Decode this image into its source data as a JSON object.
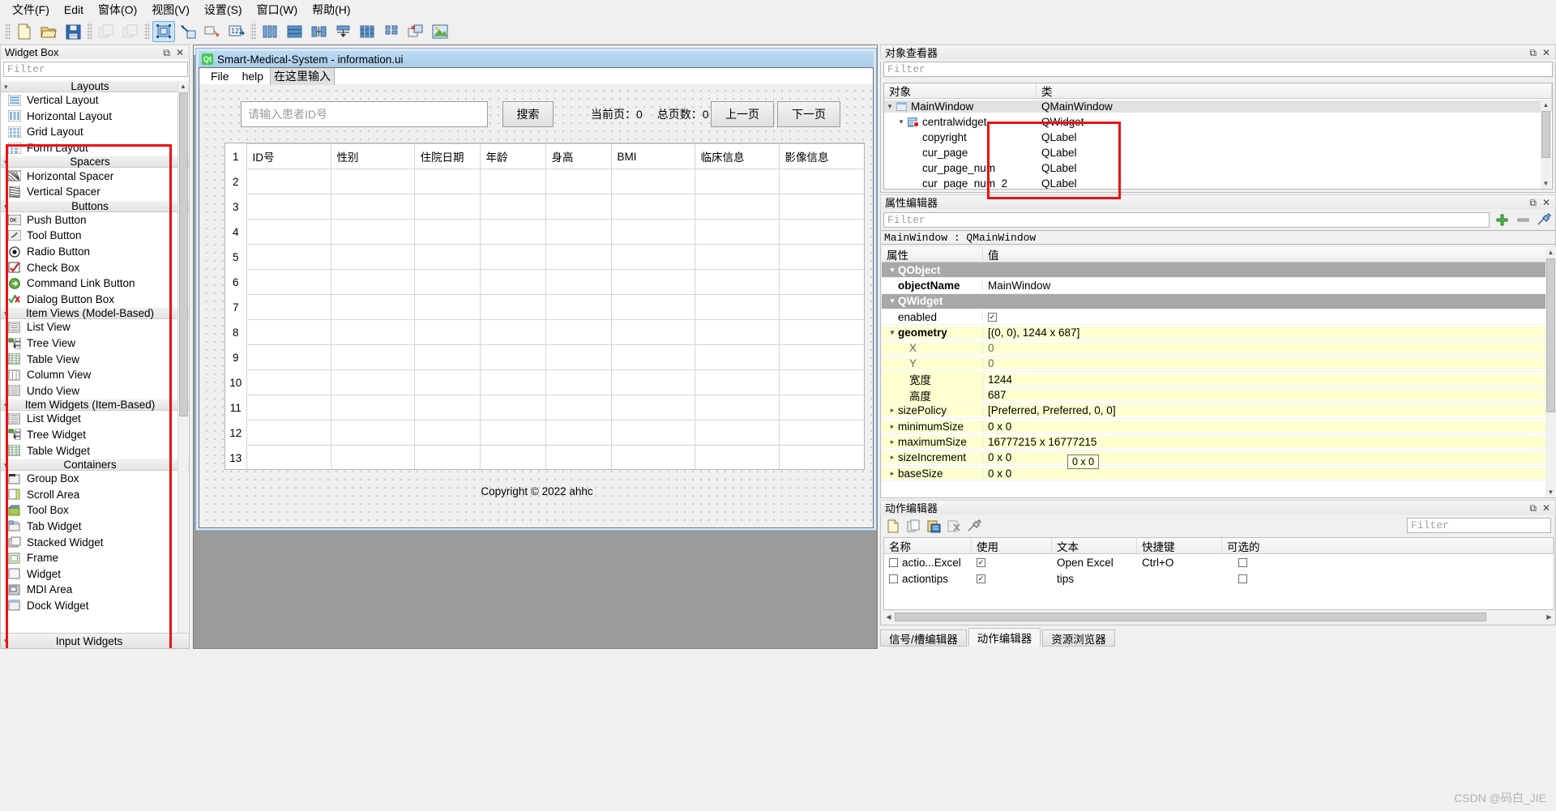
{
  "app": {
    "menu": [
      {
        "label": "文件(F)"
      },
      {
        "label": "Edit"
      },
      {
        "label": "窗体(O)"
      },
      {
        "label": "视图(V)"
      },
      {
        "label": "设置(S)"
      },
      {
        "label": "窗口(W)"
      },
      {
        "label": "帮助(H)"
      }
    ],
    "toolbar_groups": [
      {
        "buttons": [
          {
            "name": "new-form-icon",
            "enabled": true,
            "selected": false
          },
          {
            "name": "open-form-icon",
            "enabled": true,
            "selected": false
          },
          {
            "name": "save-form-icon",
            "enabled": true,
            "selected": false
          }
        ]
      },
      {
        "buttons": [
          {
            "name": "undo-icon",
            "enabled": false,
            "selected": false
          },
          {
            "name": "redo-icon",
            "enabled": false,
            "selected": false
          }
        ]
      },
      {
        "buttons": [
          {
            "name": "edit-widgets-icon",
            "enabled": true,
            "selected": true
          },
          {
            "name": "edit-signals-slots-icon",
            "enabled": true,
            "selected": false
          },
          {
            "name": "edit-buddies-icon",
            "enabled": true,
            "selected": false
          },
          {
            "name": "edit-tab-order-icon",
            "enabled": true,
            "selected": false
          }
        ]
      },
      {
        "buttons": [
          {
            "name": "layout-horizontally-icon",
            "enabled": true,
            "selected": false
          },
          {
            "name": "layout-vertically-icon",
            "enabled": true,
            "selected": false
          },
          {
            "name": "layout-splitter-horizontal-icon",
            "enabled": true,
            "selected": false
          },
          {
            "name": "layout-splitter-vertical-icon",
            "enabled": true,
            "selected": false
          },
          {
            "name": "layout-in-grid-icon",
            "enabled": true,
            "selected": false
          },
          {
            "name": "layout-in-form-icon",
            "enabled": true,
            "selected": false
          },
          {
            "name": "break-layout-icon",
            "enabled": true,
            "selected": false
          },
          {
            "name": "adjust-size-icon",
            "enabled": true,
            "selected": false
          }
        ]
      }
    ]
  },
  "widget_box": {
    "title": "Widget Box",
    "filter_placeholder": "Filter",
    "categories": [
      {
        "label": "Layouts",
        "expanded": true,
        "items": [
          {
            "label": "Vertical Layout",
            "icon": "vertical-layout-icon"
          },
          {
            "label": "Horizontal Layout",
            "icon": "horizontal-layout-icon"
          },
          {
            "label": "Grid Layout",
            "icon": "grid-layout-icon"
          },
          {
            "label": "Form Layout",
            "icon": "form-layout-icon"
          }
        ]
      },
      {
        "label": "Spacers",
        "expanded": true,
        "items": [
          {
            "label": "Horizontal Spacer",
            "icon": "horizontal-spacer-icon"
          },
          {
            "label": "Vertical Spacer",
            "icon": "vertical-spacer-icon"
          }
        ]
      },
      {
        "label": "Buttons",
        "expanded": true,
        "items": [
          {
            "label": "Push Button",
            "icon": "push-button-icon"
          },
          {
            "label": "Tool Button",
            "icon": "tool-button-icon"
          },
          {
            "label": "Radio Button",
            "icon": "radio-button-icon"
          },
          {
            "label": "Check Box",
            "icon": "check-box-icon"
          },
          {
            "label": "Command Link Button",
            "icon": "command-link-button-icon"
          },
          {
            "label": "Dialog Button Box",
            "icon": "dialog-button-box-icon"
          }
        ]
      },
      {
        "label": "Item Views (Model-Based)",
        "expanded": true,
        "items": [
          {
            "label": "List View",
            "icon": "list-view-icon"
          },
          {
            "label": "Tree View",
            "icon": "tree-view-icon"
          },
          {
            "label": "Table View",
            "icon": "table-view-icon"
          },
          {
            "label": "Column View",
            "icon": "column-view-icon"
          },
          {
            "label": "Undo View",
            "icon": "undo-view-icon"
          }
        ]
      },
      {
        "label": "Item Widgets (Item-Based)",
        "expanded": true,
        "items": [
          {
            "label": "List Widget",
            "icon": "list-widget-icon"
          },
          {
            "label": "Tree Widget",
            "icon": "tree-widget-icon"
          },
          {
            "label": "Table Widget",
            "icon": "table-widget-icon"
          }
        ]
      },
      {
        "label": "Containers",
        "expanded": true,
        "items": [
          {
            "label": "Group Box",
            "icon": "group-box-icon"
          },
          {
            "label": "Scroll Area",
            "icon": "scroll-area-icon"
          },
          {
            "label": "Tool Box",
            "icon": "tool-box-icon"
          },
          {
            "label": "Tab Widget",
            "icon": "tab-widget-icon"
          },
          {
            "label": "Stacked Widget",
            "icon": "stacked-widget-icon"
          },
          {
            "label": "Frame",
            "icon": "frame-icon"
          },
          {
            "label": "Widget",
            "icon": "widget-icon"
          },
          {
            "label": "MDI Area",
            "icon": "mdi-area-icon"
          },
          {
            "label": "Dock Widget",
            "icon": "dock-widget-icon"
          }
        ]
      }
    ],
    "bottom_category": {
      "label": "Input Widgets",
      "expanded": false
    }
  },
  "form_window": {
    "title": "Smart-Medical-System - information.ui",
    "qt_badge": "Qt",
    "menu": [
      {
        "label": "File"
      },
      {
        "label": "help"
      },
      {
        "label": "在这里输入",
        "is_hint": true
      }
    ],
    "search_input_placeholder": "请输入患者ID号",
    "search_button": "搜索",
    "page_labels": [
      {
        "label": "当前页：0"
      },
      {
        "label": "总页数：0"
      }
    ],
    "prev_button": "上一页",
    "next_button": "下一页",
    "table": {
      "columns": [
        "ID号",
        "性别",
        "住院日期",
        "年龄",
        "身高",
        "BMI",
        "临床信息",
        "影像信息"
      ],
      "row_numbers": [
        "1",
        "2",
        "3",
        "4",
        "5",
        "6",
        "7",
        "8",
        "9",
        "10",
        "11",
        "12",
        "13"
      ]
    },
    "copyright": "Copyright © 2022 ahhc"
  },
  "object_inspector": {
    "title": "对象查看器",
    "filter_placeholder": "Filter",
    "columns": [
      "对象",
      "类"
    ],
    "rows": [
      {
        "name": "MainWindow",
        "class": "QMainWindow",
        "depth": 0,
        "twisty": "v",
        "selected": true,
        "icon": "main-window-icon"
      },
      {
        "name": "centralwidget",
        "class": "QWidget",
        "depth": 1,
        "twisty": "v",
        "selected": false,
        "icon": "central-widget-icon"
      },
      {
        "name": "copyright",
        "class": "QLabel",
        "depth": 2,
        "twisty": "",
        "selected": false,
        "icon": ""
      },
      {
        "name": "cur_page",
        "class": "QLabel",
        "depth": 2,
        "twisty": "",
        "selected": false,
        "icon": ""
      },
      {
        "name": "cur_page_num",
        "class": "QLabel",
        "depth": 2,
        "twisty": "",
        "selected": false,
        "icon": ""
      },
      {
        "name": "cur_page_num_2",
        "class": "QLabel",
        "depth": 2,
        "twisty": "",
        "selected": false,
        "icon": ""
      }
    ]
  },
  "property_editor": {
    "title": "属性编辑器",
    "filter_placeholder": "Filter",
    "object_line": "MainWindow : QMainWindow",
    "columns": [
      "属性",
      "值"
    ],
    "rows": [
      {
        "key": "QObject",
        "value": "",
        "type": "group",
        "twisty": "v"
      },
      {
        "key": "objectName",
        "value": "MainWindow",
        "type": "bold",
        "twisty": ""
      },
      {
        "key": "QWidget",
        "value": "",
        "type": "group",
        "twisty": "v"
      },
      {
        "key": "enabled",
        "value": "",
        "type": "checkbox",
        "checked": true,
        "twisty": ""
      },
      {
        "key": "geometry",
        "value": "[(0, 0), 1244 x 687]",
        "type": "bold-yellow",
        "twisty": "v"
      },
      {
        "key": "X",
        "value": "0",
        "type": "sub-yellow",
        "twisty": ""
      },
      {
        "key": "Y",
        "value": "0",
        "type": "sub-yellow",
        "twisty": ""
      },
      {
        "key": "宽度",
        "value": "1244",
        "type": "sub-yellow",
        "twisty": ""
      },
      {
        "key": "高度",
        "value": "687",
        "type": "sub-yellow",
        "twisty": ""
      },
      {
        "key": "sizePolicy",
        "value": "[Preferred, Preferred, 0, 0]",
        "type": "yellow",
        "twisty": ">"
      },
      {
        "key": "minimumSize",
        "value": "0 x 0",
        "type": "yellow",
        "twisty": ">"
      },
      {
        "key": "maximumSize",
        "value": "16777215 x 16777215",
        "type": "yellow",
        "twisty": ">"
      },
      {
        "key": "sizeIncrement",
        "value": "0 x 0",
        "type": "yellow",
        "twisty": ">"
      },
      {
        "key": "baseSize",
        "value": "0 x 0",
        "type": "yellow",
        "twisty": ">"
      }
    ],
    "tooltip": "0 x 0"
  },
  "action_editor": {
    "title": "动作编辑器",
    "filter_placeholder": "Filter",
    "toolbar": [
      {
        "name": "new-action-icon"
      },
      {
        "name": "copy-action-icon"
      },
      {
        "name": "paste-action-icon"
      },
      {
        "name": "delete-action-icon"
      },
      {
        "name": "edit-action-icon"
      }
    ],
    "columns": [
      "名称",
      "使用",
      "文本",
      "快捷键",
      "可选的"
    ],
    "rows": [
      {
        "name": "actio...Excel",
        "used": true,
        "text": "Open Excel",
        "shortcut": "Ctrl+O",
        "checkable": false
      },
      {
        "name": "actiontips",
        "used": true,
        "text": "tips",
        "shortcut": "",
        "checkable": false
      }
    ]
  },
  "bottom_tabs": [
    {
      "label": "信号/槽编辑器",
      "active": false
    },
    {
      "label": "动作编辑器",
      "active": true
    },
    {
      "label": "资源浏览器",
      "active": false
    }
  ],
  "watermark": "CSDN @码白_JIE",
  "colors": {
    "accent": "#ee1111",
    "titlebar_blue": "#a9cdea",
    "qt_green": "#41cd52",
    "property_yellow": "#ffffd0",
    "group_gray": "#a8a8a8"
  }
}
